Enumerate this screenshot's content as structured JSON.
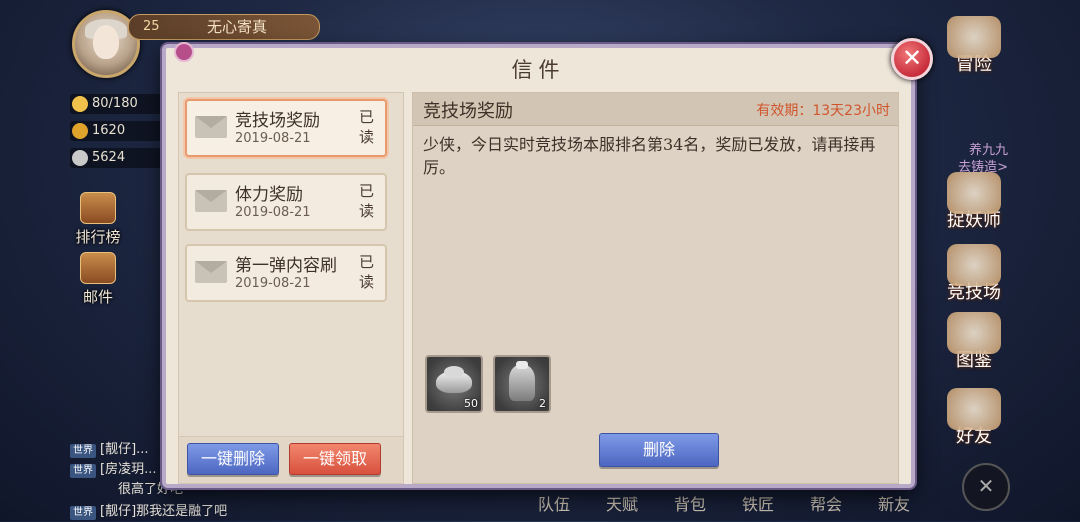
{
  "player": {
    "level": "25",
    "name": "无心寄真"
  },
  "resources": [
    {
      "icon": "stamina-bolt-icon",
      "value": "80/180",
      "color": "#f1c24b"
    },
    {
      "icon": "gold-ingot-icon",
      "value": "1620",
      "color": "#e0a42c"
    },
    {
      "icon": "coin-icon",
      "value": "5624",
      "color": "#c9c9c9"
    }
  ],
  "left_menu": [
    "排行榜",
    "邮件"
  ],
  "right_menu": [
    "冒险",
    "捉妖师",
    "竞技场",
    "图鉴",
    "好友"
  ],
  "right_misc": {
    "line1": "养九九",
    "line2": "去铸造>"
  },
  "chat": [
    {
      "tag": "世界",
      "text": "[靓仔]..."
    },
    {
      "tag": "世界",
      "text": "[房凌玥..."
    },
    {
      "tag": "",
      "text": "很高了好吧"
    },
    {
      "tag": "世界",
      "text": "[靓仔]那我还是融了吧"
    }
  ],
  "bottom_nav": [
    "队伍",
    "天赋",
    "背包",
    "铁匠",
    "帮会",
    "新友"
  ],
  "dialog": {
    "title": "信件",
    "mails": [
      {
        "subject": "竞技场奖励",
        "date": "2019-08-21",
        "status": "已读",
        "selected": true
      },
      {
        "subject": "体力奖励",
        "date": "2019-08-21",
        "status": "已读",
        "selected": false
      },
      {
        "subject": "第一弹内容刷",
        "date": "2019-08-21",
        "status": "已读",
        "selected": false
      }
    ],
    "delete_all_label": "一键删除",
    "claim_all_label": "一键领取",
    "detail": {
      "subject": "竞技场奖励",
      "expiry": "有效期：13天23小时",
      "body": "少侠，今日实时竞技场本服排名第34名，奖励已发放，请再接再厉。",
      "attachments": [
        {
          "icon": "silver-ingot-icon",
          "qty": "50"
        },
        {
          "icon": "bronze-vessel-icon",
          "qty": "2"
        }
      ],
      "delete_label": "删除"
    }
  },
  "colors": {
    "accent_red": "#d0552d",
    "button_blue": "#5b74cf",
    "button_red": "#e0644d"
  }
}
